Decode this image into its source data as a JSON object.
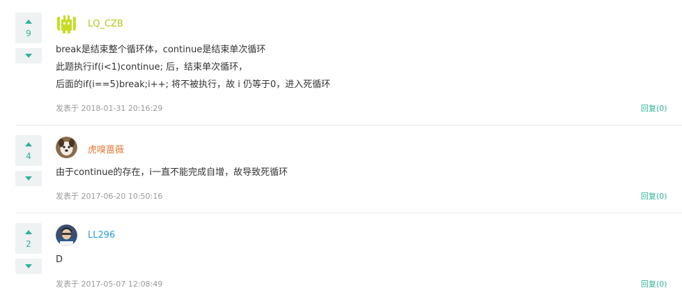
{
  "colors": {
    "accent": "#2fb39b",
    "meta_text": "#999999",
    "body_text": "#333333",
    "vote_bg": "#eef2f2"
  },
  "comments": [
    {
      "votes": "9",
      "username": "LQ_CZB",
      "username_color": "#b5c51c",
      "avatar_icon": "green-robot-avatar",
      "body_lines": [
        "break是结束整个循环体，continue是结束单次循环",
        "此题执行if(i<1)continue; 后，结束单次循环，",
        "后面的if(i==5)break;i++; 将不被执行，故 i 仍等于0，进入死循环"
      ],
      "meta": "发表于 2018-01-31 20:16:29",
      "reply_label": "回复(0)"
    },
    {
      "votes": "4",
      "username": "虎嗅蔷薇",
      "username_color": "#e07b39",
      "avatar_icon": "dog-photo-avatar",
      "body_lines": [
        "由于continue的存在，i一直不能完成自增，故导致死循环"
      ],
      "meta": "发表于 2017-06-20 10:50:16",
      "reply_label": "回复(0)"
    },
    {
      "votes": "2",
      "username": "LL296",
      "username_color": "#2a9fd6",
      "avatar_icon": "person-photo-avatar",
      "body_lines": [
        "D"
      ],
      "meta": "发表于 2017-05-07 12:08:49",
      "reply_label": "回复(0)"
    }
  ]
}
